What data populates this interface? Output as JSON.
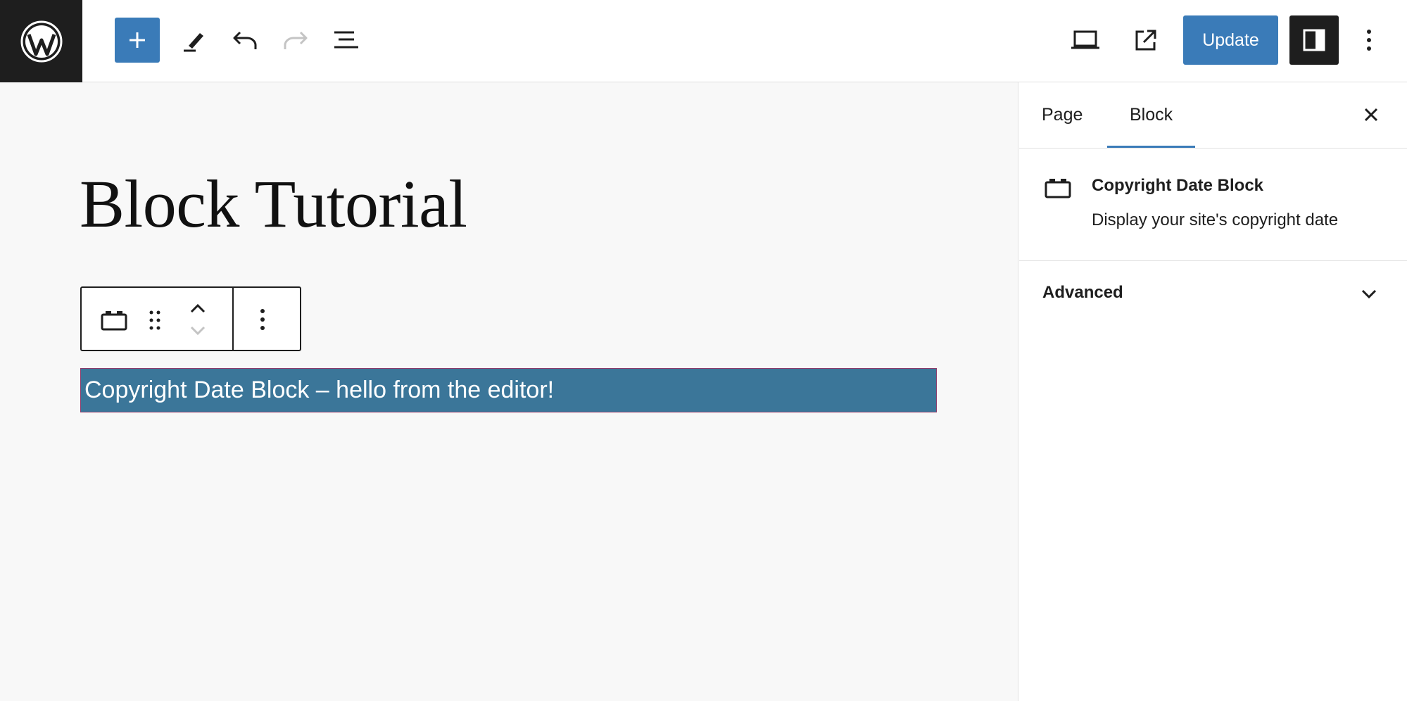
{
  "header": {
    "update_label": "Update"
  },
  "editor": {
    "title": "Block Tutorial",
    "selected_block_text": "Copyright Date Block – hello from the editor!"
  },
  "sidebar": {
    "tabs": [
      {
        "label": "Page"
      },
      {
        "label": "Block"
      }
    ],
    "block_card": {
      "title": "Copyright Date Block",
      "description": "Display your site's copyright date"
    },
    "panels": [
      {
        "label": "Advanced"
      }
    ]
  },
  "colors": {
    "accent": "#3a7bb8",
    "dark": "#1e1e1e",
    "selected_block_bg": "#3b7699"
  },
  "icons": [
    "wordpress-logo-icon",
    "plus-icon",
    "pencil-icon",
    "undo-icon",
    "redo-icon",
    "document-overview-icon",
    "desktop-preview-icon",
    "external-link-icon",
    "sidebar-toggle-icon",
    "more-vertical-icon",
    "block-calendar-icon",
    "drag-handle-icon",
    "chevron-up-icon",
    "chevron-down-icon",
    "close-icon"
  ]
}
